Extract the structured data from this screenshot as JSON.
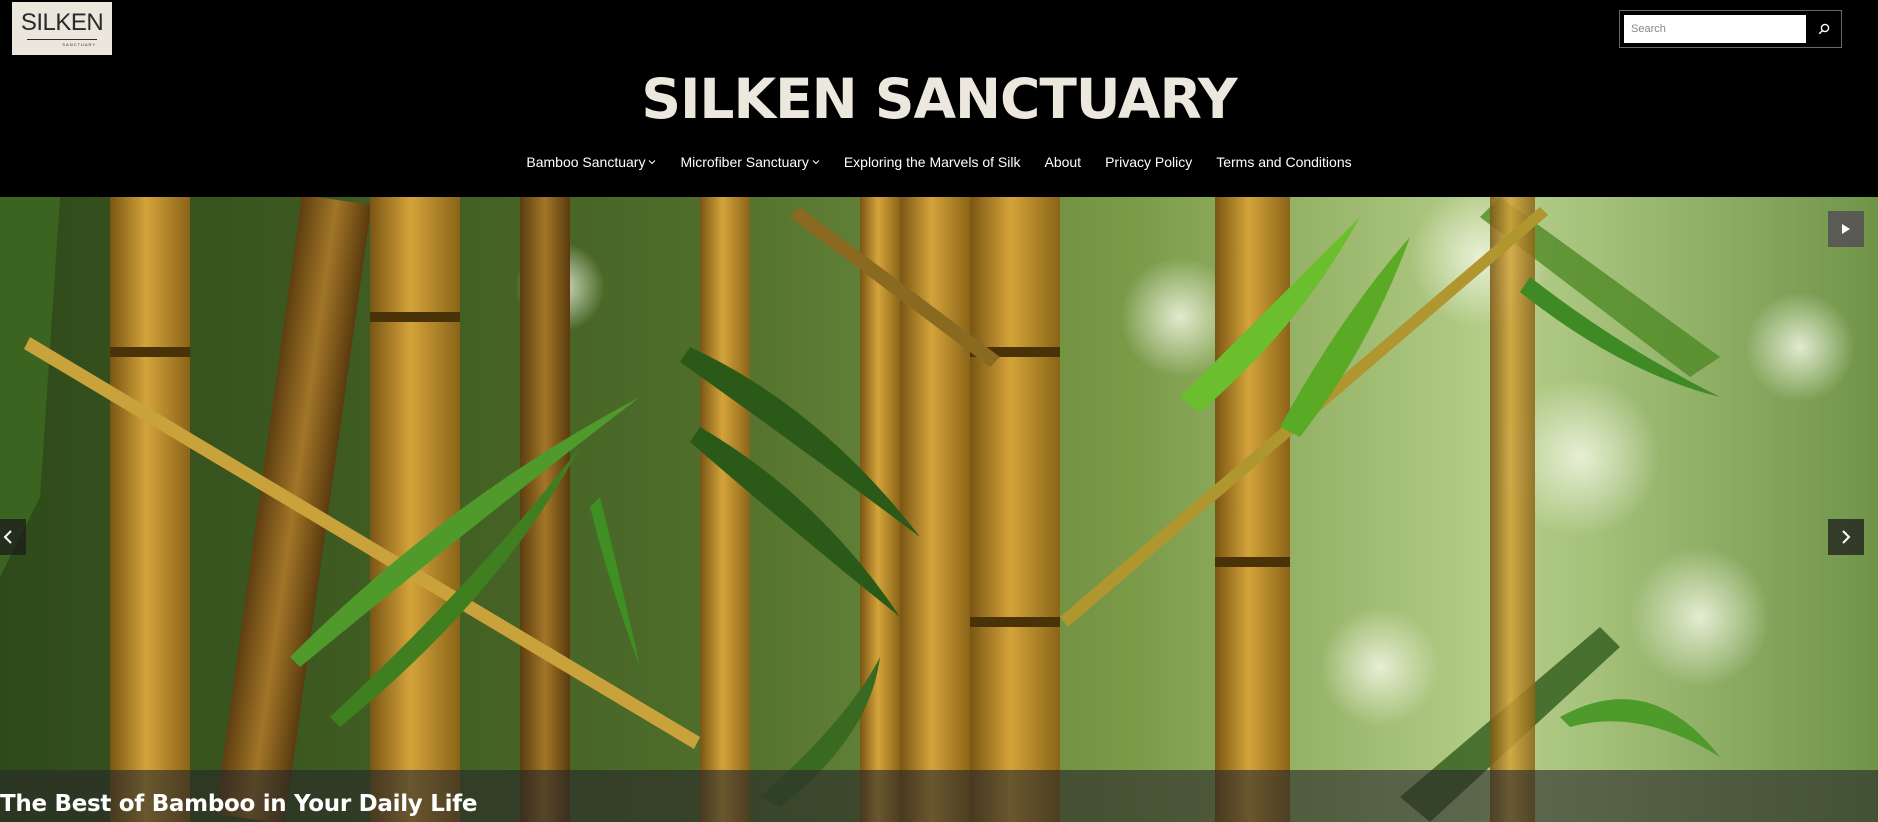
{
  "header": {
    "logo": {
      "main": "SILKEN",
      "sub": "SANCTUARY"
    },
    "site_title": "SILKEN SANCTUARY",
    "search": {
      "placeholder": "Search",
      "value": "",
      "icon": "search-icon"
    }
  },
  "nav": {
    "items": [
      {
        "label": "Bamboo Sanctuary",
        "has_dropdown": true
      },
      {
        "label": "Microfiber Sanctuary",
        "has_dropdown": true
      },
      {
        "label": "Exploring the Marvels of Silk",
        "has_dropdown": false
      },
      {
        "label": "About",
        "has_dropdown": false
      },
      {
        "label": "Privacy Policy",
        "has_dropdown": false
      },
      {
        "label": "Terms and Conditions",
        "has_dropdown": false
      }
    ]
  },
  "hero": {
    "image": "bamboo-forest-photo",
    "caption": "The Best of Bamboo in Your Daily Life",
    "controls": {
      "prev": "chevron-left-icon",
      "next": "chevron-right-icon",
      "play": "play-icon"
    }
  },
  "colors": {
    "background": "#000000",
    "title": "#ece8de",
    "logo_bg": "#ece7dc"
  }
}
